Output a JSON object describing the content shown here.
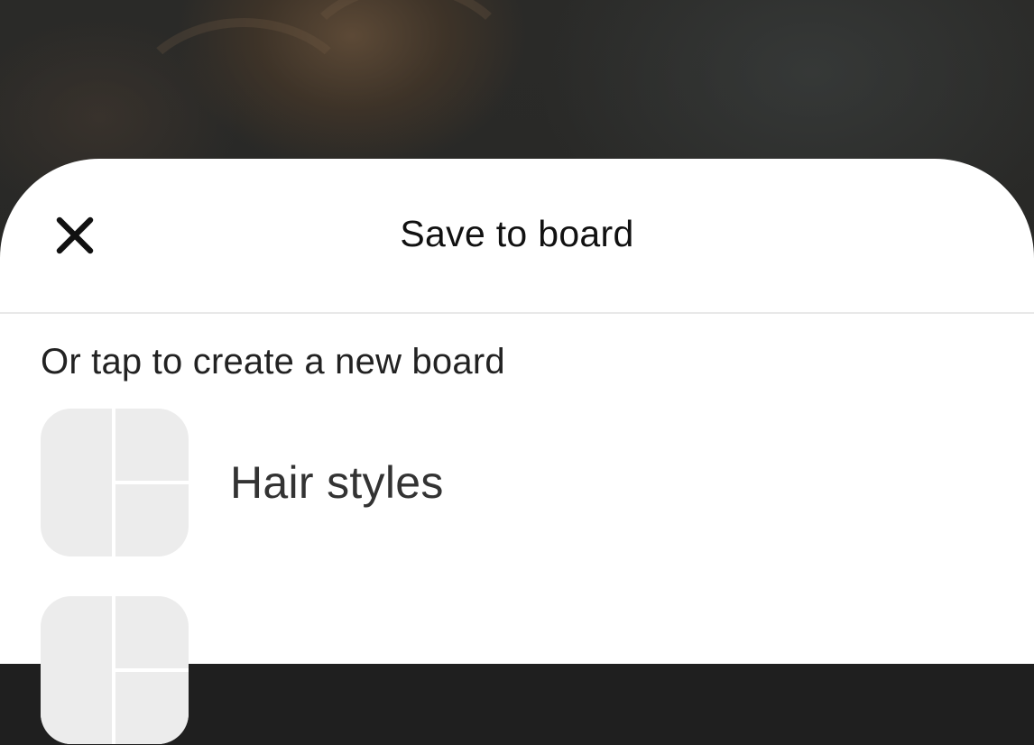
{
  "sheet": {
    "title": "Save to board",
    "close_icon": "close-icon",
    "hint": "Or tap to create a new board"
  },
  "boards": [
    {
      "name": "Hair styles",
      "thumbnail_icon": "board-placeholder-icon"
    },
    {
      "name": "",
      "thumbnail_icon": "board-placeholder-icon"
    }
  ],
  "colors": {
    "sheet_background": "#ffffff",
    "title_text": "#111111",
    "board_text": "#333333",
    "placeholder_tile": "#ececec",
    "divider": "#e8e8e8"
  }
}
